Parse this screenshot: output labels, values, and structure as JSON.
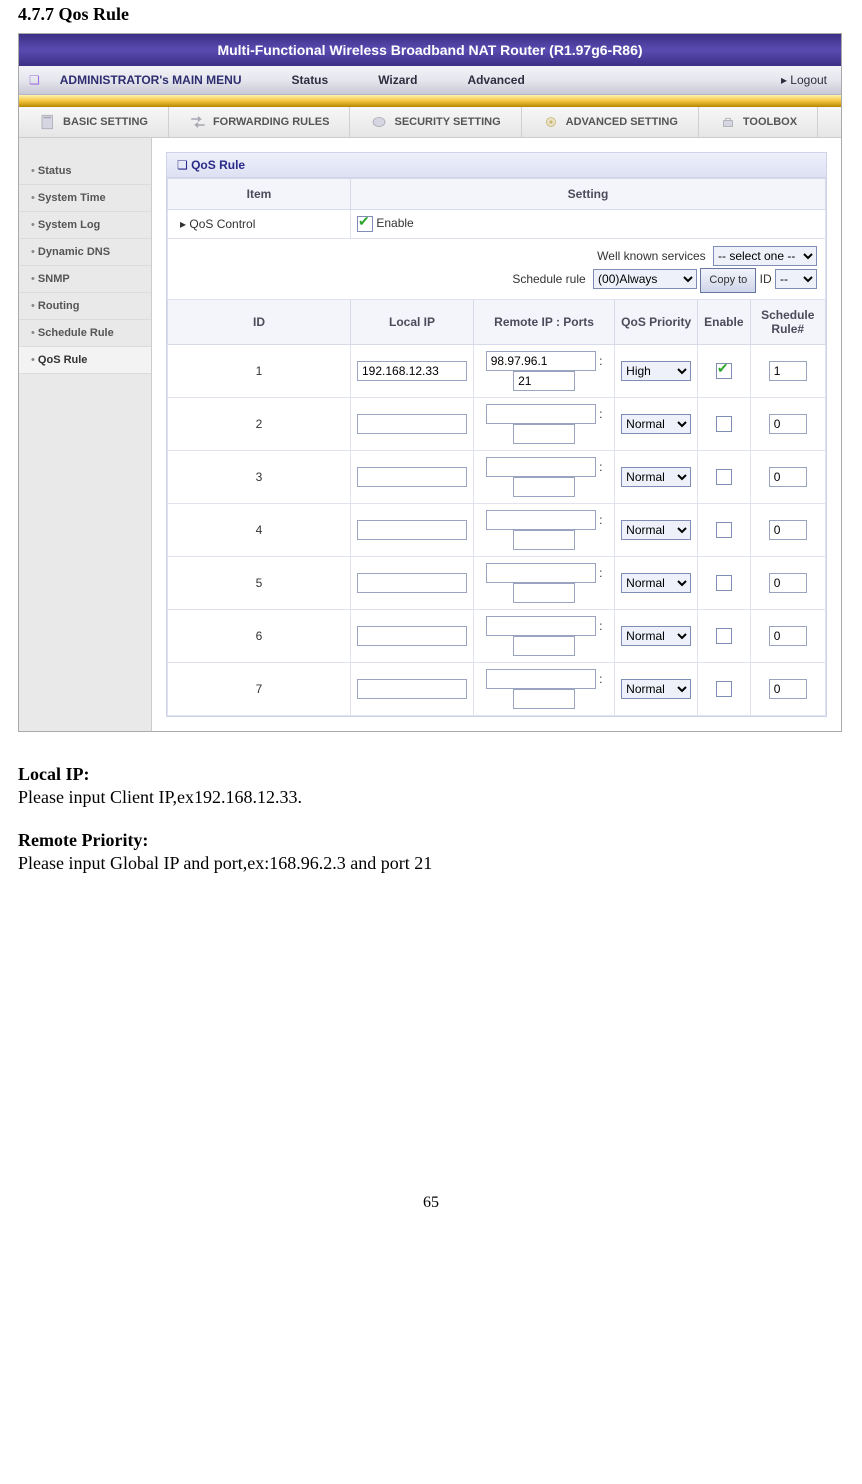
{
  "doc": {
    "section_no_title": "4.7.7 Qos Rule",
    "local_ip_h": "Local IP:",
    "local_ip_text": "Please input Client IP,ex192.168.12.33.",
    "remote_h": "Remote Priority:",
    "remote_text": "Please input Global IP and port,ex:168.96.2.3 and port 21",
    "pagenum": "65"
  },
  "banner": "Multi-Functional Wireless Broadband NAT Router (R1.97g6-R86)",
  "menubar": {
    "title": "ADMINISTRATOR's MAIN MENU",
    "items": [
      "Status",
      "Wizard",
      "Advanced"
    ],
    "logout": "▸ Logout"
  },
  "tabs": [
    "BASIC SETTING",
    "FORWARDING RULES",
    "SECURITY SETTING",
    "ADVANCED SETTING",
    "TOOLBOX"
  ],
  "sidebar": [
    "Status",
    "System Time",
    "System Log",
    "Dynamic DNS",
    "SNMP",
    "Routing",
    "Schedule Rule",
    "QoS Rule"
  ],
  "card": {
    "title": "QoS Rule",
    "col_item": "Item",
    "col_setting": "Setting",
    "qos_label": "▸ QoS Control",
    "enable_label": "Enable",
    "svc_label": "Well known services",
    "svc_sel": "-- select one --",
    "sched_label": "Schedule rule",
    "sched_sel": "(00)Always",
    "copy_btn": "Copy to",
    "id_label": "ID",
    "id_sel": "--",
    "hdr_id": "ID",
    "hdr_local": "Local IP",
    "hdr_remote": "Remote IP : Ports",
    "hdr_prio": "QoS Priority",
    "hdr_enable": "Enable",
    "hdr_sched": "Schedule Rule#"
  },
  "rows": [
    {
      "id": "1",
      "local": "192.168.12.33",
      "rip": "98.97.96.1",
      "port": "21",
      "prio": "High",
      "enabled": true,
      "sched": "1"
    },
    {
      "id": "2",
      "local": "",
      "rip": "",
      "port": "",
      "prio": "Normal",
      "enabled": false,
      "sched": "0"
    },
    {
      "id": "3",
      "local": "",
      "rip": "",
      "port": "",
      "prio": "Normal",
      "enabled": false,
      "sched": "0"
    },
    {
      "id": "4",
      "local": "",
      "rip": "",
      "port": "",
      "prio": "Normal",
      "enabled": false,
      "sched": "0"
    },
    {
      "id": "5",
      "local": "",
      "rip": "",
      "port": "",
      "prio": "Normal",
      "enabled": false,
      "sched": "0"
    },
    {
      "id": "6",
      "local": "",
      "rip": "",
      "port": "",
      "prio": "Normal",
      "enabled": false,
      "sched": "0"
    },
    {
      "id": "7",
      "local": "",
      "rip": "",
      "port": "",
      "prio": "Normal",
      "enabled": false,
      "sched": "0"
    }
  ]
}
